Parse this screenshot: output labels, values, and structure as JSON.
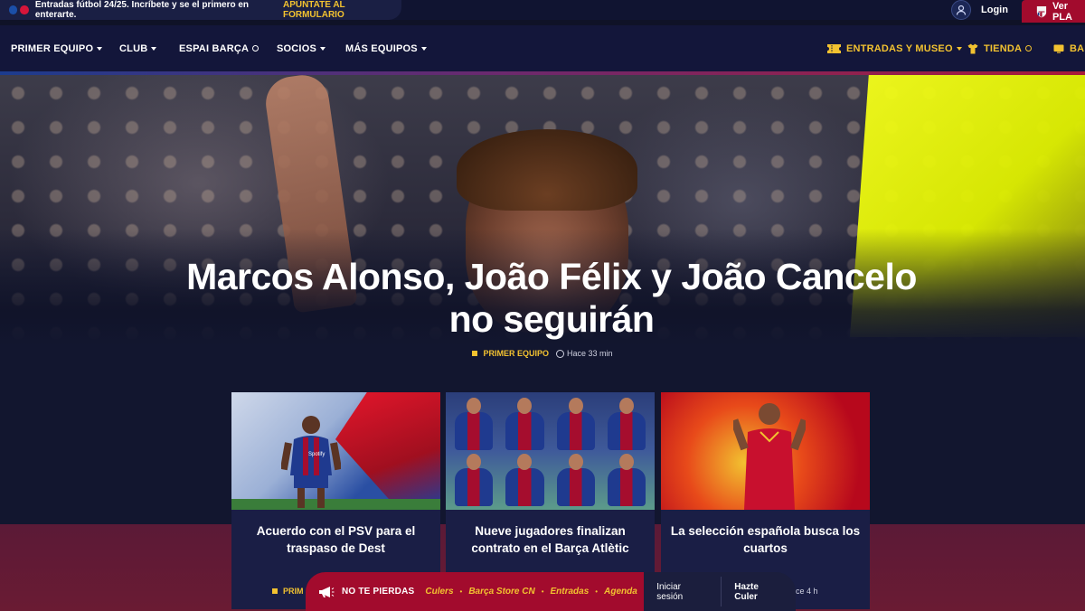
{
  "topbar": {
    "announcement": "Entradas fútbol 24/25. Incríbete y se el primero en enterarte.",
    "cta": "APÚNTATE AL FORMULARIO",
    "login": "Login",
    "ver_pla": "Ver PLA"
  },
  "nav": {
    "items": [
      {
        "label": "PRIMER EQUIPO"
      },
      {
        "label": "CLUB"
      },
      {
        "label": "ESPAI BARÇA"
      },
      {
        "label": "SOCIOS"
      },
      {
        "label": "MÁS EQUIPOS"
      }
    ],
    "right": [
      {
        "label": "ENTRADAS Y MUSEO"
      },
      {
        "label": "TIENDA"
      },
      {
        "label": "BAR"
      }
    ]
  },
  "hero": {
    "title": "Marcos Alonso, João Félix y João Cancelo no seguirán",
    "category": "PRIMER EQUIPO",
    "time": "Hace 33 min"
  },
  "cards": [
    {
      "title": "Acuerdo con el PSV para el traspaso de Dest",
      "sponsor": "Spotify"
    },
    {
      "title": "Nueve jugadores finalizan contrato en el Barça Atlètic"
    },
    {
      "title": "La selección española busca los cuartos"
    }
  ],
  "card_meta": {
    "category": "PRIM",
    "time": "ce 4 h"
  },
  "floatbar": {
    "label": "NO TE PIERDAS",
    "links": [
      "Culers",
      "Barça Store CN",
      "Entradas",
      "Agenda"
    ],
    "signin": "Iniciar sesión",
    "join": "Hazte Culer"
  },
  "colors": {
    "navy": "#13163a",
    "gold": "#f2c230",
    "blaugrana_red": "#a20b2d"
  }
}
